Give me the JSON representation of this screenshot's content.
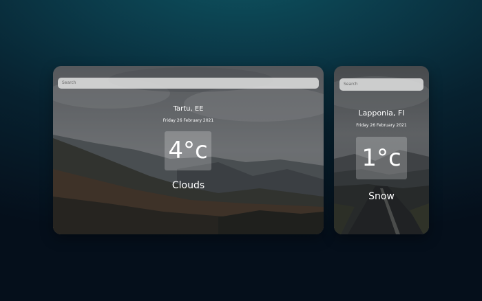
{
  "cards": [
    {
      "search_placeholder": "Search",
      "city": "Tartu, EE",
      "date": "Friday 26 February 2021",
      "temperature": "4°c",
      "condition": "Clouds"
    },
    {
      "search_placeholder": "Search",
      "city": "Lapponia, FI",
      "date": "Friday 26 February 2021",
      "temperature": "1°c",
      "condition": "Snow"
    }
  ]
}
